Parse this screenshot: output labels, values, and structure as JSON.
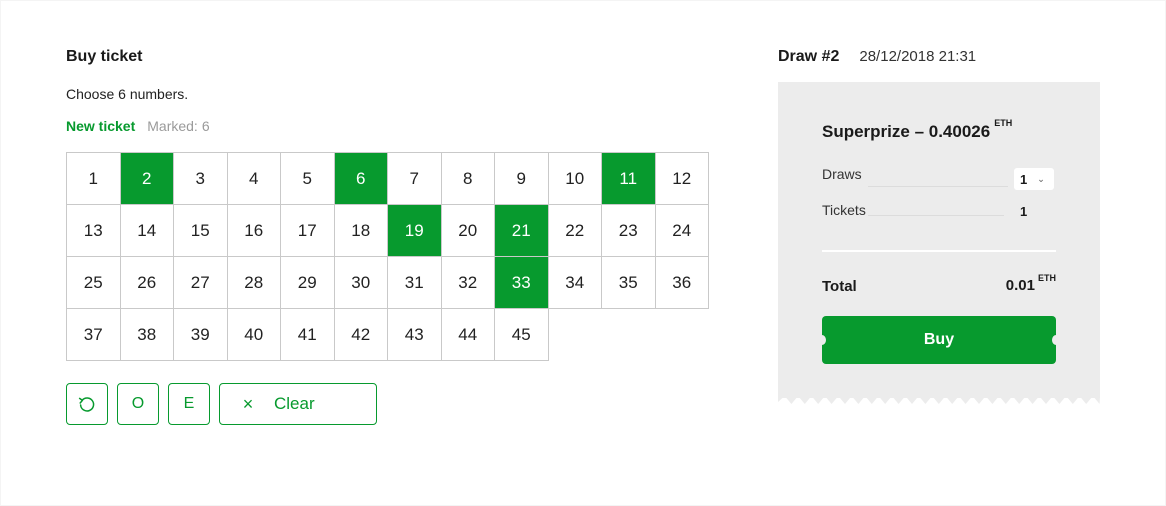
{
  "buy": {
    "title": "Buy ticket",
    "subtitle": "Choose 6 numbers.",
    "tab_new": "New ticket",
    "marked_label": "Marked:",
    "marked_count": "6",
    "numbers": [
      1,
      2,
      3,
      4,
      5,
      6,
      7,
      8,
      9,
      10,
      11,
      12,
      13,
      14,
      15,
      16,
      17,
      18,
      19,
      20,
      21,
      22,
      23,
      24,
      25,
      26,
      27,
      28,
      29,
      30,
      31,
      32,
      33,
      34,
      35,
      36,
      37,
      38,
      39,
      40,
      41,
      42,
      43,
      44,
      45
    ],
    "selected": [
      2,
      6,
      11,
      19,
      21,
      33
    ],
    "actions": {
      "reset_icon": "refresh-icon",
      "odd_label": "O",
      "even_label": "E",
      "clear_label": "Clear",
      "clear_icon": "close-icon"
    }
  },
  "draw": {
    "title": "Draw #2",
    "date": "28/12/2018 21:31",
    "superprize_label": "Superprize – 0.40026",
    "currency": "ETH",
    "draws_label": "Draws",
    "draws_value": "1",
    "tickets_label": "Tickets",
    "tickets_value": "1",
    "total_label": "Total",
    "total_value": "0.01",
    "buy_label": "Buy"
  },
  "colors": {
    "accent": "#079a2e",
    "panel": "#ececec"
  }
}
